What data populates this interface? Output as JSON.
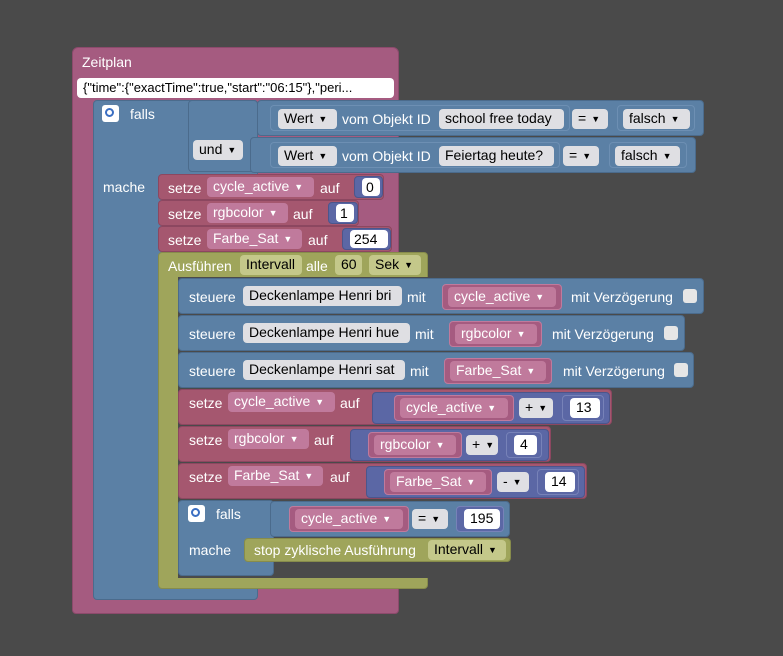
{
  "zeitplan": {
    "title": "Zeitplan",
    "schedule_json": "{\"time\":{\"exactTime\":true,\"start\":\"06:15\"},\"peri..."
  },
  "if1": {
    "falls": "falls",
    "mache": "mache",
    "cond1": {
      "wert": "Wert",
      "vom": "vom Objekt ID",
      "id": "school free today",
      "op": "=",
      "val": "falsch"
    },
    "und": "und",
    "cond2": {
      "wert": "Wert",
      "vom": "vom Objekt ID",
      "id": "Feiertag heute?",
      "op": "=",
      "val": "falsch"
    }
  },
  "sets": [
    {
      "setze": "setze",
      "var": "cycle_active",
      "auf": "auf",
      "val": "0"
    },
    {
      "setze": "setze",
      "var": "rgbcolor",
      "auf": "auf",
      "val": "1"
    },
    {
      "setze": "setze",
      "var": "Farbe_Sat",
      "auf": "auf",
      "val": "254"
    }
  ],
  "interval": {
    "exec": "Ausführen",
    "name": "Intervall",
    "alle": "alle",
    "val": "60",
    "unit": "Sek"
  },
  "controls": [
    {
      "steuere": "steuere",
      "obj": "Deckenlampe Henri bri",
      "mit": "mit",
      "var": "cycle_active",
      "delay": "mit Verzögerung"
    },
    {
      "steuere": "steuere",
      "obj": "Deckenlampe Henri hue",
      "mit": "mit",
      "var": "rgbcolor",
      "delay": "mit Verzögerung"
    },
    {
      "steuere": "steuere",
      "obj": "Deckenlampe Henri sat",
      "mit": "mit",
      "var": "Farbe_Sat",
      "delay": "mit Verzögerung"
    }
  ],
  "mathsets": [
    {
      "setze": "setze",
      "var": "cycle_active",
      "auf": "auf",
      "var2": "cycle_active",
      "op": "+",
      "val": "13"
    },
    {
      "setze": "setze",
      "var": "rgbcolor",
      "auf": "auf",
      "var2": "rgbcolor",
      "op": "+",
      "val": "4"
    },
    {
      "setze": "setze",
      "var": "Farbe_Sat",
      "auf": "auf",
      "var2": "Farbe_Sat",
      "op": "-",
      "val": "14"
    }
  ],
  "if2": {
    "falls": "falls",
    "mache": "mache",
    "var": "cycle_active",
    "op": "=",
    "val": "195",
    "stop": "stop zyklische Ausführung",
    "stop_name": "Intervall"
  }
}
